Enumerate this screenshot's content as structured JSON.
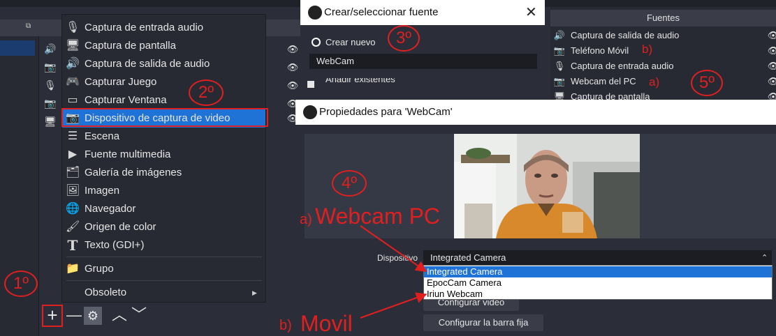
{
  "menu": {
    "items": [
      {
        "label": "Captura de entrada audio",
        "icon": "microphone-icon"
      },
      {
        "label": "Captura de pantalla",
        "icon": "monitor-icon"
      },
      {
        "label": "Captura de salida de audio",
        "icon": "speaker-icon"
      },
      {
        "label": "Capturar Juego",
        "icon": "gamepad-icon"
      },
      {
        "label": "Capturar Ventana",
        "icon": "window-icon"
      },
      {
        "label": "Dispositivo de captura de video",
        "icon": "camera-icon"
      },
      {
        "label": "Escena",
        "icon": "list-icon"
      },
      {
        "label": "Fuente multimedia",
        "icon": "play-icon"
      },
      {
        "label": "Galería de imágenes",
        "icon": "gallery-icon"
      },
      {
        "label": "Imagen",
        "icon": "image-icon"
      },
      {
        "label": "Navegador",
        "icon": "globe-icon"
      },
      {
        "label": "Origen de color",
        "icon": "brush-icon"
      },
      {
        "label": "Texto (GDI+)",
        "icon": "text-icon"
      },
      {
        "label": "Grupo",
        "icon": "folder-icon"
      },
      {
        "label": "Obsoleto",
        "icon": ""
      }
    ]
  },
  "create_dialog": {
    "title": "Crear/seleccionar fuente",
    "create_new_label": "Crear nuevo",
    "name_value": "WebCam",
    "add_existing_label": "Añadir existentes"
  },
  "sources_panel": {
    "header": "Fuentes",
    "items": [
      {
        "label": "Captura de salida de audio",
        "icon": "speaker-icon"
      },
      {
        "label": "Teléfono Móvil",
        "icon": "camera-icon"
      },
      {
        "label": "Captura de entrada audio",
        "icon": "microphone-icon"
      },
      {
        "label": "Webcam del PC",
        "icon": "camera-icon"
      },
      {
        "label": "Captura de pantalla",
        "icon": "monitor-icon"
      }
    ]
  },
  "properties_dialog": {
    "title": "Propiedades para 'WebCam'",
    "device_label": "Dispositivo",
    "device_value": "Integrated Camera",
    "device_options": [
      "Integrated Camera",
      "EpocCam Camera",
      "Iriun Webcam"
    ],
    "configure_video_label": "Configurar video",
    "configure_crossbar_label": "Configurar la barra fija"
  },
  "annotations": {
    "step1": "1º",
    "step2": "2º",
    "step3": "3º",
    "step4": "4º",
    "step5": "5º",
    "a_label": "a)",
    "b_label": "b)",
    "webcam_pc": "Webcam PC",
    "movil": "Movil",
    "a_small": "a)",
    "b_small": "b)"
  },
  "colors": {
    "accent": "#1f72d6",
    "annotation": "#e02020",
    "background": "#2b2e38"
  }
}
